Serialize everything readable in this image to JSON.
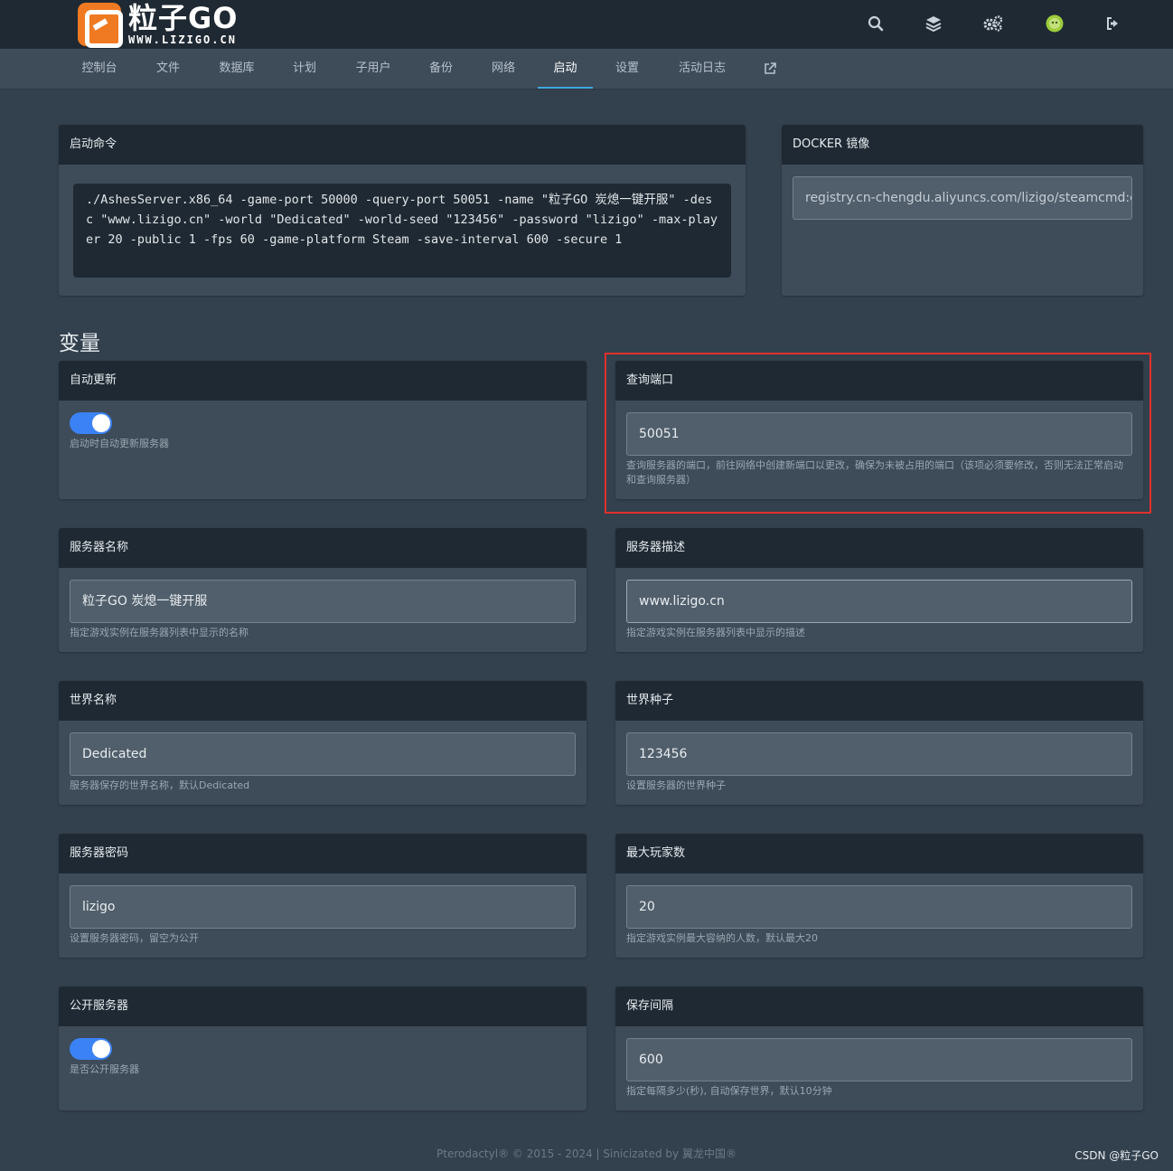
{
  "brand": {
    "name": "粒子GO",
    "url": "WWW.LIZIGO.CN"
  },
  "topbar": {
    "icons": [
      "search-icon",
      "layers-icon",
      "gears-icon",
      "avatar",
      "sign-out-icon"
    ]
  },
  "nav": {
    "items": [
      "控制台",
      "文件",
      "数据库",
      "计划",
      "子用户",
      "备份",
      "网络",
      "启动",
      "设置",
      "活动日志"
    ],
    "active": "启动",
    "external_icon": "external-link-icon"
  },
  "startup": {
    "title": "启动命令",
    "command": "./AshesServer.x86_64 -game-port 50000 -query-port 50051 -name \"粒子GO 炭熄一键开服\" -desc \"www.lizigo.cn\" -world \"Dedicated\" -world-seed \"123456\" -password \"lizigo\" -max-player 20 -public 1 -fps 60 -game-platform Steam -save-interval 600 -secure 1"
  },
  "docker": {
    "title": "DOCKER 镜像",
    "image": "registry.cn-chengdu.aliyuncs.com/lizigo/steamcmd:c"
  },
  "variables_title": "变量",
  "variables": {
    "auto_update": {
      "title": "自动更新",
      "enabled": true,
      "hint": "启动时自动更新服务器"
    },
    "query_port": {
      "title": "查询端口",
      "value": "50051",
      "hint": "查询服务器的端口，前往网络中创建新端口以更改，确保为未被占用的端口（该项必须要修改，否则无法正常启动和查询服务器）"
    },
    "server_name": {
      "title": "服务器名称",
      "value": "粒子GO 炭熄一键开服",
      "hint": "指定游戏实例在服务器列表中显示的名称"
    },
    "server_desc": {
      "title": "服务器描述",
      "value": "www.lizigo.cn",
      "hint": "指定游戏实例在服务器列表中显示的描述"
    },
    "world_name": {
      "title": "世界名称",
      "value": "Dedicated",
      "hint": "服务器保存的世界名称，默认Dedicated"
    },
    "world_seed": {
      "title": "世界种子",
      "value": "123456",
      "hint": "设置服务器的世界种子"
    },
    "password": {
      "title": "服务器密码",
      "value": "lizigo",
      "hint": "设置服务器密码，留空为公开"
    },
    "max_players": {
      "title": "最大玩家数",
      "value": "20",
      "hint": "指定游戏实例最大容纳的人数，默认最大20"
    },
    "public": {
      "title": "公开服务器",
      "enabled": true,
      "hint": "是否公开服务器"
    },
    "save_interval": {
      "title": "保存间隔",
      "value": "600",
      "hint": "指定每隔多少(秒), 自动保存世界，默认10分钟"
    }
  },
  "footer": "Pterodactyl® © 2015 - 2024 | Sinicizated by 翼龙中国®",
  "watermark": "CSDN @粒子GO",
  "colors": {
    "accent": "#3fa7dc",
    "toggle": "#3b82f6",
    "highlight": "#e0312d",
    "logo": "#f07a22"
  }
}
